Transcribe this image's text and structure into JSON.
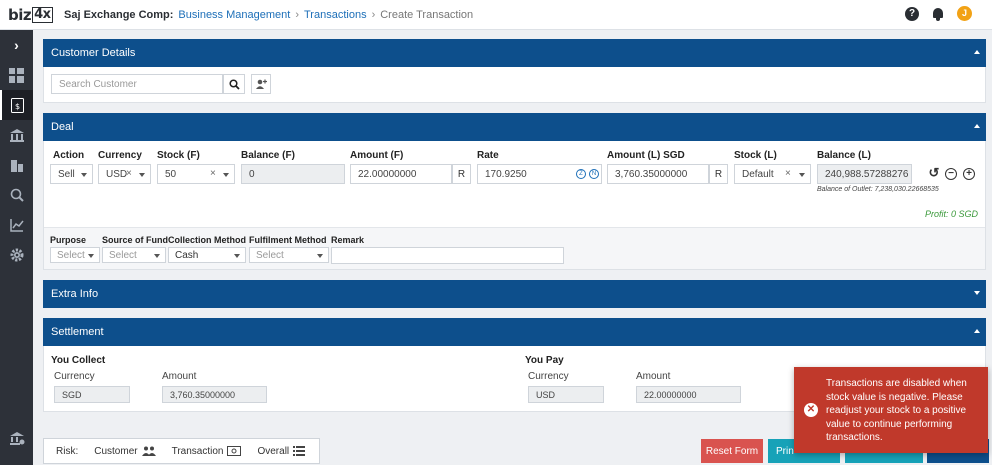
{
  "header": {
    "logo_text": "biz",
    "logo_box": "4x",
    "company": "Saj Exchange Comp:",
    "breadcrumb": [
      "Business Management",
      "Transactions",
      "Create Transaction"
    ],
    "help_icon": "?",
    "avatar_initial": "J"
  },
  "sidebar": {
    "toggle": "›",
    "items": [
      "dashboard-icon",
      "transactions-icon",
      "bank-icon",
      "buildings-icon",
      "search-report-icon",
      "chart-icon",
      "gear-icon"
    ],
    "bottom": "bank-settings-icon"
  },
  "customer_details": {
    "title": "Customer Details",
    "search_placeholder": "Search Customer"
  },
  "deal": {
    "title": "Deal",
    "labels": {
      "action": "Action",
      "currency": "Currency",
      "stock_f": "Stock (F)",
      "balance_f": "Balance (F)",
      "amount_f": "Amount (F)",
      "rate": "Rate",
      "amount_l": "Amount (L) SGD",
      "stock_l": "Stock (L)",
      "balance_l": "Balance (L)"
    },
    "values": {
      "action": "Sell",
      "currency": "USD",
      "stock_f": "50",
      "balance_f": "0",
      "amount_f": "22.00000000",
      "amount_f_suffix": "R",
      "rate": "170.9250",
      "rate_z": "Z",
      "rate_n": "N",
      "amount_l": "3,760.35000000",
      "amount_l_suffix": "R",
      "stock_l": "Default",
      "balance_l": "240,988.57288276"
    },
    "balance_of_outlet": "Balance of Outlet: 7,238,030.22668535",
    "profit": "Profit: 0 SGD",
    "extra_labels": {
      "purpose": "Purpose",
      "source": "Source of Fund",
      "collection": "Collection Method",
      "fulfilment": "Fulfilment Method",
      "remark": "Remark"
    },
    "extra_values": {
      "purpose": "Select",
      "source": "Select",
      "collection": "Cash",
      "fulfilment": "Select"
    }
  },
  "extra_info": {
    "title": "Extra Info"
  },
  "settlement": {
    "title": "Settlement",
    "collect": {
      "title": "You Collect",
      "currency_label": "Currency",
      "amount_label": "Amount",
      "currency": "SGD",
      "amount": "3,760.35000000"
    },
    "pay": {
      "title": "You Pay",
      "currency_label": "Currency",
      "amount_label": "Amount",
      "currency": "USD",
      "amount": "22.00000000"
    }
  },
  "bottom_bar": {
    "risk": "Risk:",
    "customer": "Customer",
    "transaction": "Transaction",
    "overall": "Overall"
  },
  "buttons": {
    "reset": "Reset Form",
    "print": "Prin"
  },
  "colors": {
    "primary": "#0d4f8c",
    "sidebar": "#2d3139",
    "reset": "#d9534f",
    "print": "#17a2b8",
    "toast": "#c0392b",
    "profit": "#3c9a3c"
  },
  "toast": {
    "message": "Transactions are disabled when stock value is negative. Please readjust your stock to a positive value to continue performing transactions."
  }
}
